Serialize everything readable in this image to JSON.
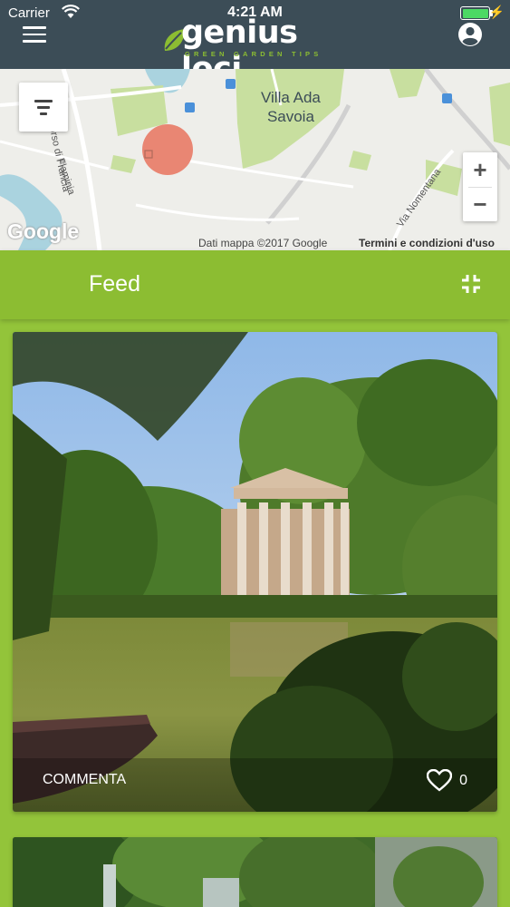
{
  "status_bar": {
    "carrier": "Carrier",
    "time": "4:21 AM"
  },
  "header": {
    "brand": "genius loci",
    "tagline": "GREEN GARDEN TIPS",
    "menu_icon": "hamburger-menu-icon",
    "account_icon": "user-account-icon"
  },
  "map": {
    "labels": {
      "park": "Villa Ada\nSavoia",
      "road_1": "Corso di Francia",
      "road_2": "Flaminia",
      "road_3": "Via Nomentana"
    },
    "google_logo": "Google",
    "attribution": "Dati mappa ©2017 Google",
    "terms": "Termini e condizioni d'uso",
    "zoom_in": "+",
    "zoom_out": "−"
  },
  "feed": {
    "title": "Feed",
    "collapse_icon": "collapse-icon",
    "posts": [
      {
        "comment_label": "COMMENTA",
        "likes": "0"
      }
    ]
  },
  "colors": {
    "header": "#3c4d57",
    "accent": "#8cbd32"
  }
}
